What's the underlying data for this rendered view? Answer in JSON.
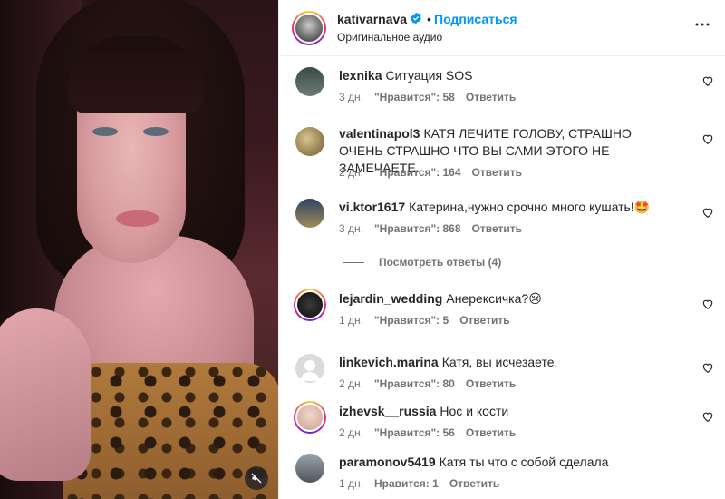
{
  "post": {
    "username": "kativarnava",
    "follow_label": "Подписаться",
    "separator": "•",
    "audio_label": "Оригинальное аудио"
  },
  "comments": [
    {
      "user": "lexnika",
      "text": "Ситуация SOS",
      "time": "3 дн.",
      "likes": "\"Нравится\": 58",
      "reply": "Ответить",
      "avatar_color": "#5d6a64"
    },
    {
      "user": "valentinapol3",
      "text": "КАТЯ ЛЕЧИТЕ ГОЛОВУ, СТРАШНО ОЧЕНЬ СТРАШНО ЧТО ВЫ САМИ ЭТОГО НЕ ЗАМЕЧАЕТЕ.",
      "time": "2 дн.",
      "likes": "\"Нравится\": 164",
      "reply": "Ответить",
      "avatar_color": "#8c6b3a"
    },
    {
      "user": "vi.ktor1617",
      "text": "Катерина,нужно срочно много кушать!🤩",
      "time": "3 дн.",
      "likes": "\"Нравится\": 868",
      "reply": "Ответить",
      "avatar_color": "#3d4f6e"
    },
    {
      "user": "lejardin_wedding",
      "text": "Анерексичка?😢",
      "time": "1 дн.",
      "likes": "\"Нравится\": 5",
      "reply": "Ответить",
      "avatar_color": "#1a1a1a"
    },
    {
      "user": "linkevich.marina",
      "text": "Катя, вы исчезаете.",
      "time": "2 дн.",
      "likes": "\"Нравится\": 80",
      "reply": "Ответить",
      "avatar_color": "#c7c7c7"
    },
    {
      "user": "izhevsk__russia",
      "text": "Нос и кости",
      "time": "2 дн.",
      "likes": "\"Нравится\": 56",
      "reply": "Ответить",
      "avatar_color": "#e0b7a8"
    },
    {
      "user": "paramonov5419",
      "text": "Катя ты что с собой сделала",
      "time": "1 дн.",
      "likes": "Нравится: 1",
      "reply": "Ответить",
      "avatar_color": "#7a7f86"
    }
  ],
  "view_replies_label": "Посмотреть ответы (4)",
  "icons": {
    "verified": "verified-badge-icon",
    "more": "more-options-icon",
    "heart": "heart-icon",
    "mute": "muted-speaker-icon"
  },
  "colors": {
    "link": "#0095f6",
    "secondary_text": "#737373"
  }
}
